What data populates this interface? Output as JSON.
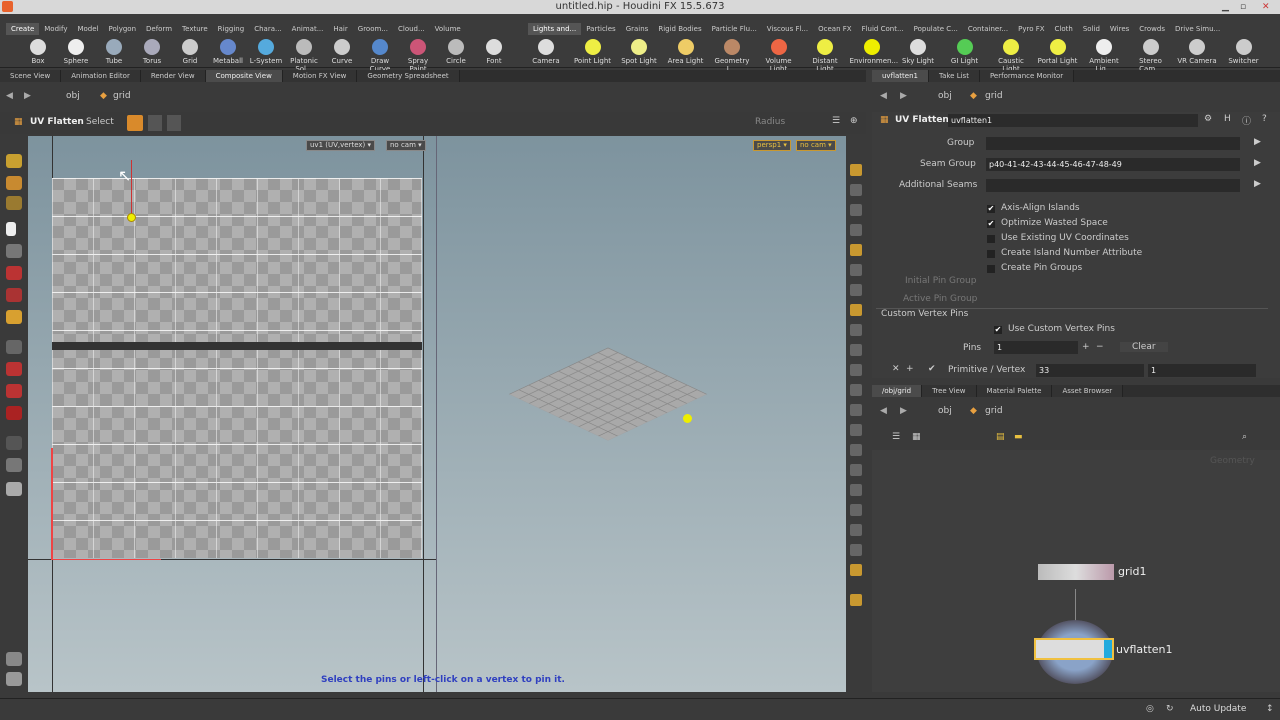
{
  "window": {
    "title": "untitled.hip - Houdini FX 15.5.673"
  },
  "shelf": {
    "left_tabs": [
      "Create",
      "Modify",
      "Model",
      "Polygon",
      "Deform",
      "Texture",
      "Rigging",
      "Chara...",
      "Animat...",
      "Hair",
      "Groom...",
      "Cloud...",
      "Volume"
    ],
    "right_tabs": [
      "Lights and...",
      "Particles",
      "Grains",
      "Rigid Bodies",
      "Particle Flu...",
      "Viscous Fl...",
      "Ocean FX",
      "Fluid Cont...",
      "Populate C...",
      "Container...",
      "Pyro FX",
      "Cloth",
      "Solid",
      "Wires",
      "Crowds",
      "Drive Simu..."
    ],
    "left_tools": [
      "Box",
      "Sphere",
      "Tube",
      "Torus",
      "Grid",
      "Metaball",
      "L-System",
      "Platonic Sol...",
      "Curve",
      "Draw Curve",
      "Spray Paint",
      "Circle",
      "Font"
    ],
    "right_tools": [
      "Camera",
      "Point Light",
      "Spot Light",
      "Area Light",
      "Geometry L...",
      "Volume Light",
      "Distant Light",
      "Environmen...",
      "Sky Light",
      "GI Light",
      "Caustic Light",
      "Portal Light",
      "Ambient Lig...",
      "Stereo Cam...",
      "VR Camera",
      "Switcher"
    ]
  },
  "left_panel": {
    "tabs": [
      "Scene View",
      "Animation Editor",
      "Render View",
      "Composite View",
      "Motion FX View",
      "Geometry Spreadsheet"
    ],
    "path": {
      "obj": "obj",
      "node": "grid"
    },
    "tool_title": "UV Flatten",
    "mode": "Select",
    "radius_label": "Radius",
    "uv_menu": "uv1 (UV,vertex)",
    "cam_menu_left": "no cam",
    "persp_menu": "persp1",
    "cam_menu_right": "no cam",
    "status": "Select the pins or left-click on a vertex to pin it."
  },
  "params": {
    "tabs": [
      "uvflatten1",
      "Take List",
      "Performance Monitor"
    ],
    "path": {
      "obj": "obj",
      "node": "grid"
    },
    "node_type": "UV Flatten",
    "node_name": "uvflatten1",
    "group_label": "Group",
    "seam_group_label": "Seam Group",
    "seam_group_value": "p40-41-42-43-44-45-46-47-48-49",
    "additional_seams_label": "Additional Seams",
    "checks": [
      {
        "label": "Axis-Align Islands",
        "on": true
      },
      {
        "label": "Optimize Wasted Space",
        "on": true
      },
      {
        "label": "Use Existing UV Coordinates",
        "on": false
      },
      {
        "label": "Create Island Number Attribute",
        "on": false
      },
      {
        "label": "Create Pin Groups",
        "on": false
      }
    ],
    "initial_pin_group_label": "Initial Pin Group",
    "active_pin_group_label": "Active Pin Group",
    "custom_pins_section": "Custom Vertex Pins",
    "use_custom_label": "Use Custom Vertex Pins",
    "pins_label": "Pins",
    "pins_value": "1",
    "clear_label": "Clear",
    "prim_label": "Primitive / Vertex",
    "prim_value": "33",
    "vertex_value": "1"
  },
  "network": {
    "tabs": [
      "/obj/grid",
      "Tree View",
      "Material Palette",
      "Asset Browser"
    ],
    "path": {
      "obj": "obj",
      "node": "grid"
    },
    "watermark": "Geometry",
    "nodes": [
      {
        "name": "grid1"
      },
      {
        "name": "uvflatten1"
      }
    ]
  },
  "statusbar": {
    "auto_update": "Auto Update"
  }
}
